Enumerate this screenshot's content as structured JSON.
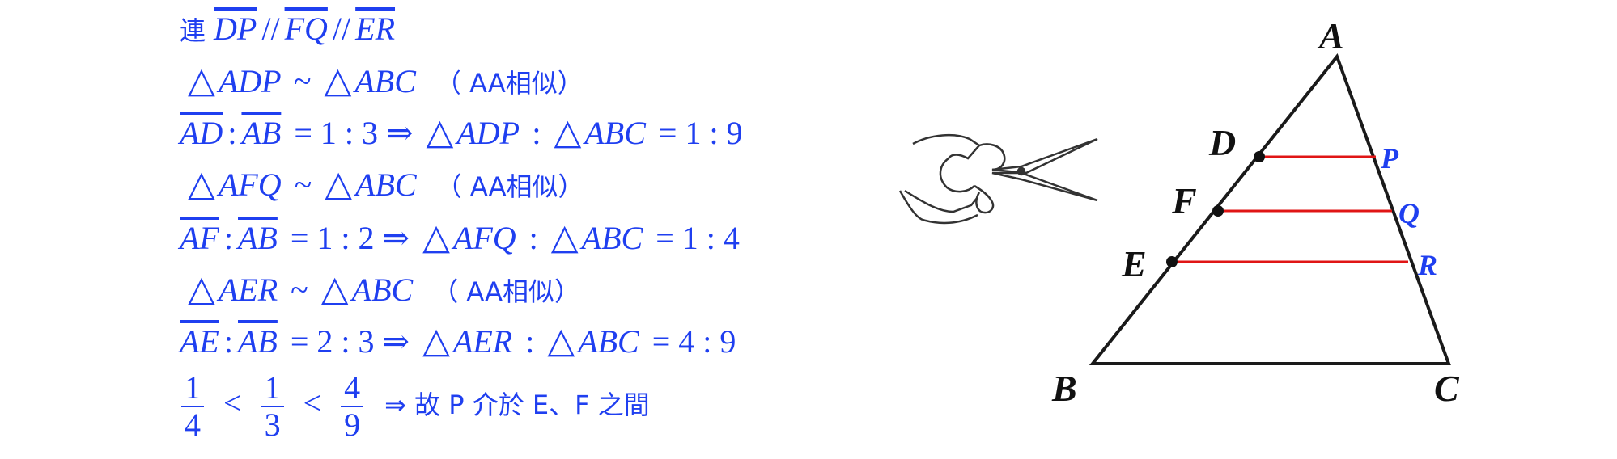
{
  "line1": {
    "prefix": "連",
    "seg1": "DP",
    "sep1": "//",
    "seg2": "FQ",
    "sep2": "//",
    "seg3": "ER"
  },
  "line2": {
    "tri1": "ADP",
    "sim": "~",
    "tri2": "ABC",
    "note": "（ AA相似）"
  },
  "line3": {
    "seg1": "AD",
    "colon": ":",
    "seg2": "AB",
    "eq": "= 1 : 3 ⇒",
    "tri1": "ADP",
    "colon2": ":",
    "tri2": "ABC",
    "result": "= 1 : 9"
  },
  "line4": {
    "tri1": "AFQ",
    "sim": "~",
    "tri2": "ABC",
    "note": "（ AA相似）"
  },
  "line5": {
    "seg1": "AF",
    "colon": ":",
    "seg2": "AB",
    "eq": "= 1 : 2 ⇒",
    "tri1": "AFQ",
    "colon2": ":",
    "tri2": "ABC",
    "result": "= 1 : 4"
  },
  "line6": {
    "tri1": "AER",
    "sim": "~",
    "tri2": "ABC",
    "note": "（ AA相似）"
  },
  "line7": {
    "seg1": "AE",
    "colon": ":",
    "seg2": "AB",
    "eq": "= 2 : 3 ⇒",
    "tri1": "AER",
    "colon2": ":",
    "tri2": "ABC",
    "result": "= 4 : 9"
  },
  "line8": {
    "frac1": {
      "num": "1",
      "den": "4"
    },
    "lt1": "<",
    "frac2": {
      "num": "1",
      "den": "3"
    },
    "lt2": "<",
    "frac3": {
      "num": "4",
      "den": "9"
    },
    "conclusion": "⇒ 故 P 介於 E、F 之間"
  },
  "figure": {
    "labels": {
      "A": "A",
      "B": "B",
      "C": "C",
      "D": "D",
      "E": "E",
      "F": "F",
      "P": "P",
      "Q": "Q",
      "R": "R"
    },
    "triangle_color": "#1a1a1a",
    "parallel_color": "#e01515",
    "label_color_vertex": "#111111",
    "label_color_side": "#1f3ff0"
  },
  "colors": {
    "text": "#1f3ff0"
  }
}
